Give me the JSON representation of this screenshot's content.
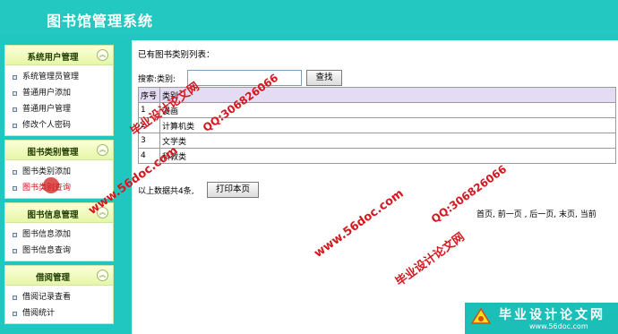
{
  "app": {
    "title": "图书馆管理系统"
  },
  "sidebar": {
    "menus": [
      {
        "title": "系统用户管理",
        "items": [
          "系统管理员管理",
          "普通用户添加",
          "普通用户管理",
          "修改个人密码"
        ]
      },
      {
        "title": "图书类别管理",
        "items": [
          "图书类别添加",
          "图书类别查询"
        ],
        "active_index": 1
      },
      {
        "title": "图书信息管理",
        "items": [
          "图书信息添加",
          "图书信息查询"
        ]
      },
      {
        "title": "借阅管理",
        "items": [
          "借阅记录查看",
          "借阅统计"
        ]
      }
    ],
    "toggle_icon": "double-chevron-up-icon"
  },
  "main": {
    "list_title": "已有图书类别列表：",
    "search": {
      "label": "搜索:类别:",
      "value": "",
      "button": "查找"
    },
    "table": {
      "headers": [
        "序号",
        "类别"
      ],
      "rows": [
        [
          "1",
          "漫画"
        ],
        [
          "2",
          "计算机类"
        ],
        [
          "3",
          "文学类"
        ],
        [
          "4",
          "科教类"
        ]
      ]
    },
    "summary": "以上数据共4条,",
    "print_button": "打印本页",
    "pager": "首页, 前一页 , 后一页, 末页, 当前"
  },
  "watermarks": {
    "texts": [
      "毕业设计论文网",
      "QQ:306826066",
      "www.56doc.com",
      "www.56doc.com",
      "QQ:306826066",
      "毕业设计论文网"
    ],
    "color": "#d4181f"
  },
  "brand": {
    "name": "毕业设计论文网",
    "site": "www.56doc.com"
  }
}
